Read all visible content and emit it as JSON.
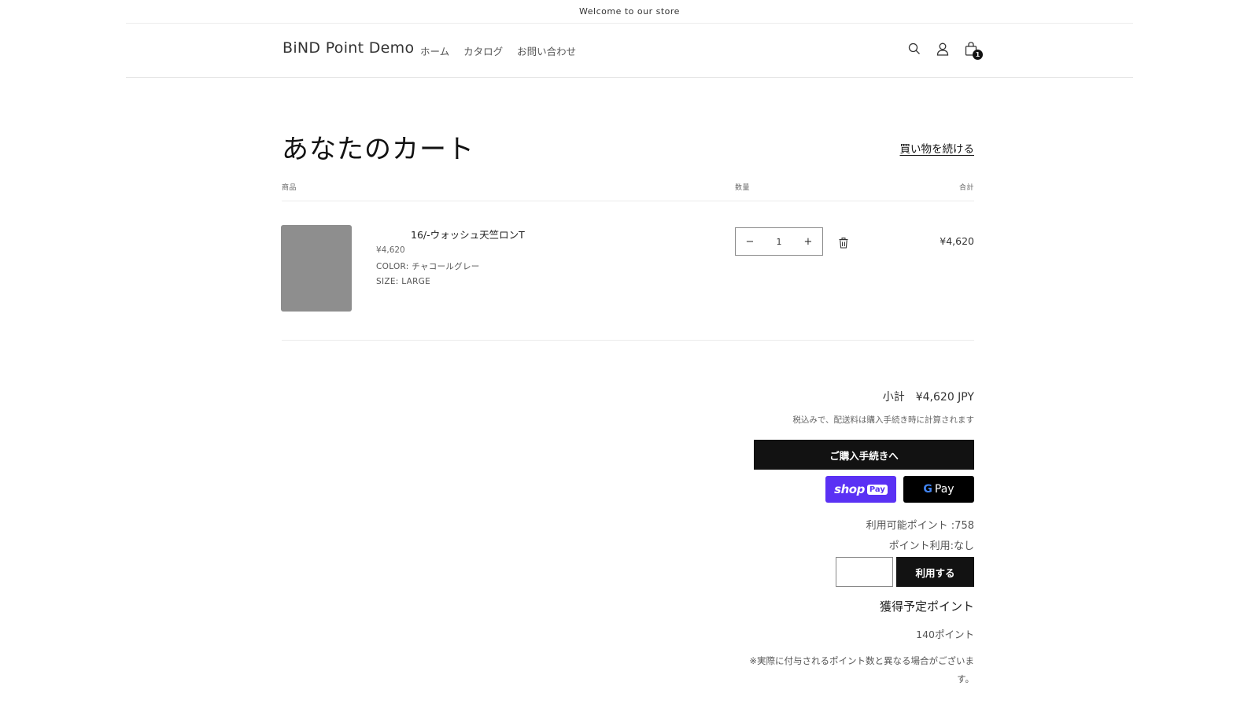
{
  "announcement": "Welcome to our store",
  "header": {
    "logo": "BiND Point Demo",
    "nav": [
      {
        "label": "ホーム"
      },
      {
        "label": "カタログ"
      },
      {
        "label": "お問い合わせ"
      }
    ],
    "icons": {
      "search": "search-icon",
      "account": "user-icon",
      "cart": "cart-icon"
    },
    "cart_count": "1"
  },
  "cart": {
    "title": "あなたのカート",
    "continue_shopping": "買い物を続ける",
    "columns": {
      "product": "商品",
      "quantity": "数量",
      "total": "合計"
    },
    "items": [
      {
        "name": "16/-ウォッシュ天竺ロンT",
        "price": "¥4,620",
        "color": "COLOR: チャコールグレー",
        "size": "SIZE: LARGE",
        "quantity": "1",
        "line_total": "¥4,620"
      }
    ]
  },
  "summary": {
    "subtotal_label": "小計",
    "subtotal_value": "¥4,620 JPY",
    "tax_note": "税込みで、配送料は購入手続き時に計算されます",
    "checkout_label": "ご購入手続きへ",
    "shop_pay_label": "Pay",
    "gpay_label": "Pay"
  },
  "points": {
    "available": "利用可能ポイント :758",
    "usage": "ポイント利用:なし",
    "input_value": "",
    "apply_label": "利用する",
    "earn_heading": "獲得予定ポイント",
    "earn_value": "140ポイント",
    "note": "※実際に付与されるポイント数と異なる場合がございます。"
  },
  "colors": {
    "accent": "#121212",
    "shop_pay": "#5a31f4",
    "gpay": "#000000"
  }
}
